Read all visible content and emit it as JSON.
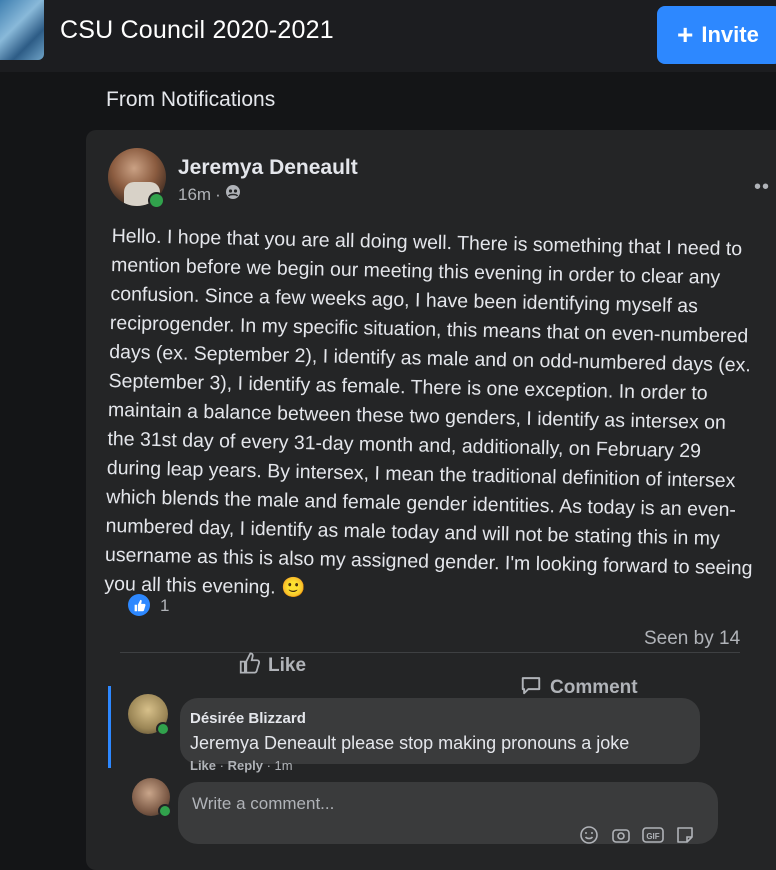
{
  "header": {
    "group_title": "CSU Council 2020-2021",
    "invite_label": "Invite",
    "from_label": "From Notifications"
  },
  "post": {
    "author": "Jeremya Deneault",
    "time": "16m",
    "separator": "·",
    "body": "Hello. I hope that you are all doing well. There is something that I need to mention before we begin our meeting this evening in order to clear any confusion. Since a few weeks ago, I have been identifying myself as reciprogender. In my specific situation, this means that on even-numbered days (ex. September 2), I identify as male and on odd-numbered days (ex. September 3), I identify as female. There is one exception. In order to maintain a balance between these two genders, I identify as intersex on the 31st day of every 31-day month and, additionally, on February 29 during leap years. By intersex, I mean the traditional definition of intersex which blends the male and female gender identities. As today is an even-numbered day, I identify as male today and will not be stating this in my username as this is also my assigned gender. I'm looking forward to seeing you all this evening.",
    "emoji": "🙂",
    "reaction_count": "1",
    "seen_by": "Seen by 14",
    "like_label": "Like",
    "comment_label": "Comment"
  },
  "comment": {
    "author": "Désirée Blizzard",
    "text": "Jeremya Deneault please stop making pronouns a joke",
    "like_label": "Like",
    "reply_label": "Reply",
    "time": "1m"
  },
  "composer": {
    "placeholder": "Write a comment..."
  },
  "colors": {
    "accent": "#2d88ff",
    "card": "#242526",
    "online": "#31a24c"
  },
  "icons": [
    "shield-icon",
    "more-options-icon",
    "like-reaction-icon",
    "like-icon",
    "comment-icon",
    "emoji-icon",
    "camera-icon",
    "gif-icon",
    "sticker-icon"
  ]
}
